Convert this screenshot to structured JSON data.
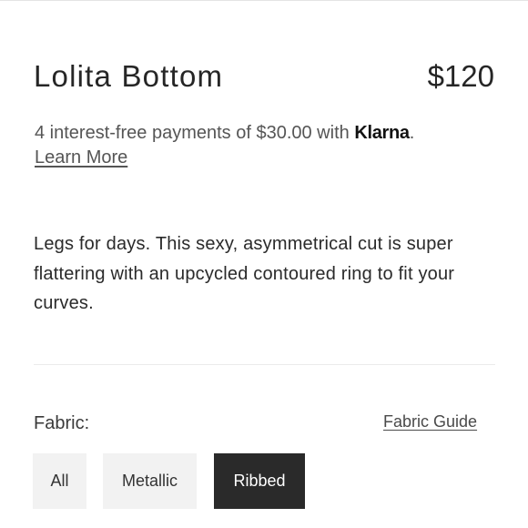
{
  "product": {
    "title": "Lolita Bottom",
    "price": "$120"
  },
  "klarna": {
    "text_before": "4 interest-free payments of $30.00 with ",
    "brand": "Klarna",
    "text_after": ".",
    "learn_more": "Learn More"
  },
  "description": "Legs for days. This sexy, asymmetrical cut is super flattering with an upcycled contoured ring to fit your curves.",
  "fabric": {
    "label": "Fabric:",
    "guide_link": "Fabric Guide",
    "options": [
      {
        "label": "All",
        "selected": false
      },
      {
        "label": "Metallic",
        "selected": false
      },
      {
        "label": "Ribbed",
        "selected": true
      }
    ]
  },
  "colors": {
    "selected_bg": "#2a2a2a",
    "option_bg": "#f2f2f2",
    "text": "#2a2a2a"
  }
}
